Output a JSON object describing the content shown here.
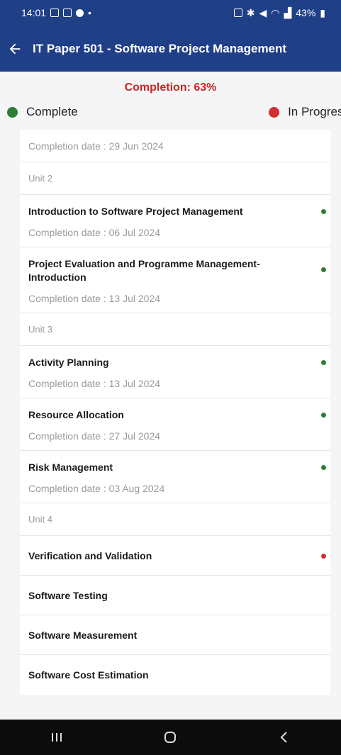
{
  "status_bar": {
    "time": "14:01",
    "right_text": "43%"
  },
  "header": {
    "title": "IT Paper 501 - Software Project Management"
  },
  "completion": {
    "text": "Completion: 63%",
    "percent": 63
  },
  "legend": {
    "complete_label": "Complete",
    "in_progress_label": "In Progress",
    "complete_color": "#2e7d32",
    "in_progress_color": "#d32f2f"
  },
  "list": {
    "first_date": "Completion date : 29 Jun 2024",
    "unit2": {
      "label": "Unit 2",
      "topics": [
        {
          "title": "Introduction to Software Project Management",
          "date": "Completion date : 06 Jul 2024",
          "status": "complete"
        },
        {
          "title": "Project Evaluation and Programme Management-Introduction",
          "date": "Completion date : 13 Jul 2024",
          "status": "complete"
        }
      ]
    },
    "unit3": {
      "label": "Unit 3",
      "topics": [
        {
          "title": "Activity Planning",
          "date": "Completion date : 13 Jul 2024",
          "status": "complete"
        },
        {
          "title": "Resource Allocation",
          "date": "Completion date : 27 Jul 2024",
          "status": "complete"
        },
        {
          "title": "Risk Management",
          "date": "Completion date : 03 Aug 2024",
          "status": "complete"
        }
      ]
    },
    "unit4": {
      "label": "Unit 4",
      "topics": [
        {
          "title": "Verification and Validation",
          "status": "in-progress"
        },
        {
          "title": "Software Testing",
          "status": "none"
        },
        {
          "title": "Software Measurement",
          "status": "none"
        },
        {
          "title": "Software Cost Estimation",
          "status": "none"
        }
      ]
    }
  }
}
